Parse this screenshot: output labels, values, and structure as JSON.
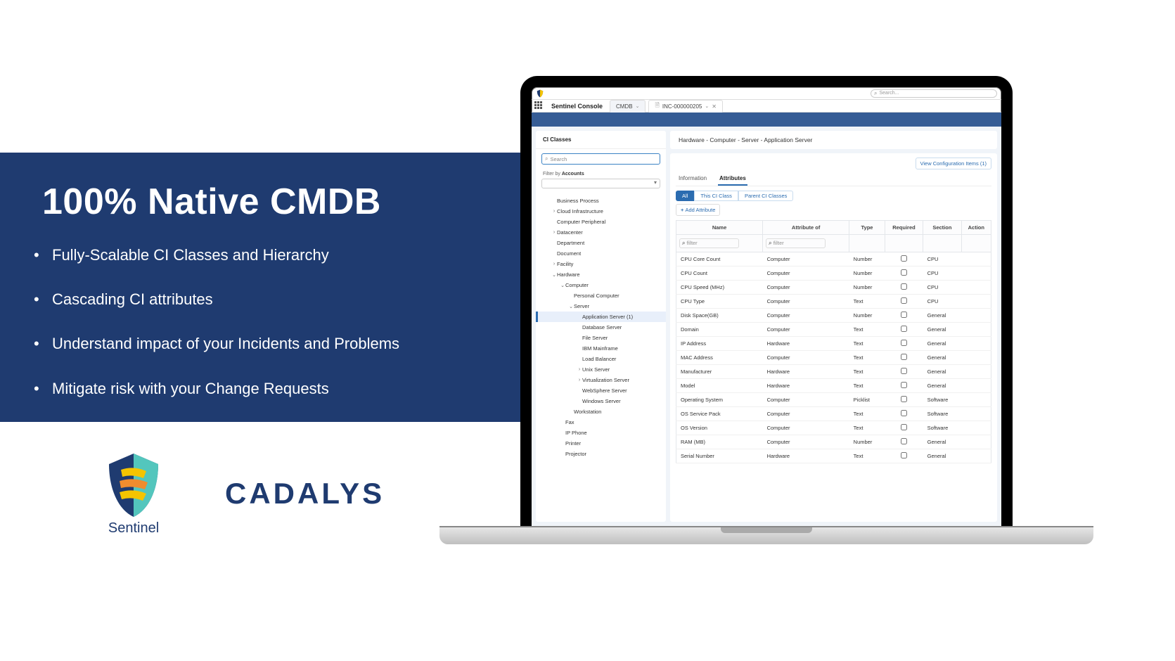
{
  "marketing": {
    "headline": "100% Native CMDB",
    "bullets": [
      "Fully-Scalable CI Classes and Hierarchy",
      "Cascading CI attributes",
      "Understand impact of your Incidents and Problems",
      "Mitigate risk with your Change Requests"
    ],
    "sentinel_label": "Sentinel",
    "cadalys_label": "CADALYS"
  },
  "app": {
    "global_search_placeholder": "Search...",
    "app_title": "Sentinel Console",
    "tabs": [
      {
        "label": "CMDB",
        "has_chevron": true,
        "has_close": false,
        "icon": null
      },
      {
        "label": "INC-000000205",
        "has_chevron": true,
        "has_close": true,
        "icon": "case"
      }
    ],
    "left": {
      "title": "CI Classes",
      "search_placeholder": "Search",
      "filter_label_prefix": "Filter by ",
      "filter_label_bold": "Accounts",
      "tree": [
        {
          "label": "Business Process",
          "indent": 1,
          "caret": ""
        },
        {
          "label": "Cloud Infrastructure",
          "indent": 1,
          "caret": "›"
        },
        {
          "label": "Computer Peripheral",
          "indent": 1,
          "caret": ""
        },
        {
          "label": "Datacenter",
          "indent": 1,
          "caret": "›"
        },
        {
          "label": "Department",
          "indent": 1,
          "caret": ""
        },
        {
          "label": "Document",
          "indent": 1,
          "caret": ""
        },
        {
          "label": "Facility",
          "indent": 1,
          "caret": "›"
        },
        {
          "label": "Hardware",
          "indent": 1,
          "caret": "⌄"
        },
        {
          "label": "Computer",
          "indent": 2,
          "caret": "⌄"
        },
        {
          "label": "Personal Computer",
          "indent": 3,
          "caret": ""
        },
        {
          "label": "Server",
          "indent": 3,
          "caret": "⌄"
        },
        {
          "label": "Application Server (1)",
          "indent": 4,
          "caret": "",
          "selected": true
        },
        {
          "label": "Database Server",
          "indent": 4,
          "caret": ""
        },
        {
          "label": "File Server",
          "indent": 4,
          "caret": ""
        },
        {
          "label": "IBM Mainframe",
          "indent": 4,
          "caret": ""
        },
        {
          "label": "Load Balancer",
          "indent": 4,
          "caret": ""
        },
        {
          "label": "Unix Server",
          "indent": 4,
          "caret": "›"
        },
        {
          "label": "Virtualization Server",
          "indent": 4,
          "caret": "›"
        },
        {
          "label": "WebSphere Server",
          "indent": 4,
          "caret": ""
        },
        {
          "label": "Windows Server",
          "indent": 4,
          "caret": ""
        },
        {
          "label": "Workstation",
          "indent": 3,
          "caret": ""
        },
        {
          "label": "Fax",
          "indent": 2,
          "caret": ""
        },
        {
          "label": "IP Phone",
          "indent": 2,
          "caret": ""
        },
        {
          "label": "Printer",
          "indent": 2,
          "caret": ""
        },
        {
          "label": "Projector",
          "indent": 2,
          "caret": ""
        }
      ]
    },
    "right": {
      "breadcrumb": "Hardware - Computer - Server - Application Server",
      "view_items_label": "View Configuration Items (1)",
      "subtabs": {
        "info": "Information",
        "attrs": "Attributes"
      },
      "pills": {
        "all": "All",
        "this": "This CI Class",
        "parent": "Parent CI Classes"
      },
      "add_attr": "Add Attribute",
      "columns": [
        "Name",
        "Attribute of",
        "Type",
        "Required",
        "Section",
        "Action"
      ],
      "filter_placeholder": "filter",
      "rows": [
        {
          "name": "CPU Core Count",
          "of": "Computer",
          "type": "Number",
          "req": false,
          "section": "CPU"
        },
        {
          "name": "CPU Count",
          "of": "Computer",
          "type": "Number",
          "req": false,
          "section": "CPU"
        },
        {
          "name": "CPU Speed (MHz)",
          "of": "Computer",
          "type": "Number",
          "req": false,
          "section": "CPU"
        },
        {
          "name": "CPU Type",
          "of": "Computer",
          "type": "Text",
          "req": false,
          "section": "CPU"
        },
        {
          "name": "Disk Space(GB)",
          "of": "Computer",
          "type": "Number",
          "req": false,
          "section": "General"
        },
        {
          "name": "Domain",
          "of": "Computer",
          "type": "Text",
          "req": false,
          "section": "General"
        },
        {
          "name": "IP Address",
          "of": "Hardware",
          "type": "Text",
          "req": false,
          "section": "General"
        },
        {
          "name": "MAC Address",
          "of": "Computer",
          "type": "Text",
          "req": false,
          "section": "General"
        },
        {
          "name": "Manufacturer",
          "of": "Hardware",
          "type": "Text",
          "req": false,
          "section": "General"
        },
        {
          "name": "Model",
          "of": "Hardware",
          "type": "Text",
          "req": false,
          "section": "General"
        },
        {
          "name": "Operating System",
          "of": "Computer",
          "type": "Picklist",
          "req": false,
          "section": "Software"
        },
        {
          "name": "OS Service Pack",
          "of": "Computer",
          "type": "Text",
          "req": false,
          "section": "Software"
        },
        {
          "name": "OS Version",
          "of": "Computer",
          "type": "Text",
          "req": false,
          "section": "Software"
        },
        {
          "name": "RAM (MB)",
          "of": "Computer",
          "type": "Number",
          "req": false,
          "section": "General"
        },
        {
          "name": "Serial Number",
          "of": "Hardware",
          "type": "Text",
          "req": false,
          "section": "General"
        }
      ]
    }
  }
}
